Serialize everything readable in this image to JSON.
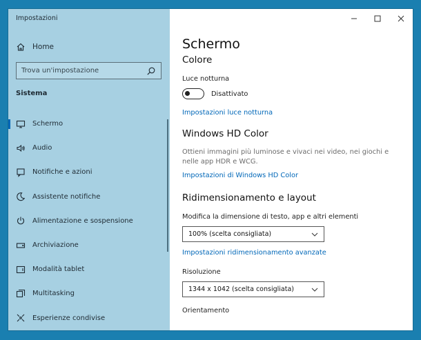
{
  "window": {
    "title": "Impostazioni"
  },
  "sidebar": {
    "home_label": "Home",
    "search_placeholder": "Trova un'impostazione",
    "section": "Sistema",
    "items": [
      {
        "label": "Schermo",
        "icon": "monitor-icon",
        "active": true
      },
      {
        "label": "Audio",
        "icon": "speaker-icon"
      },
      {
        "label": "Notifiche e azioni",
        "icon": "notification-icon"
      },
      {
        "label": "Assistente notifiche",
        "icon": "moon-icon"
      },
      {
        "label": "Alimentazione e sospensione",
        "icon": "power-icon"
      },
      {
        "label": "Archiviazione",
        "icon": "storage-icon"
      },
      {
        "label": "Modalità tablet",
        "icon": "tablet-icon"
      },
      {
        "label": "Multitasking",
        "icon": "multitasking-icon"
      },
      {
        "label": "Esperienze condivise",
        "icon": "shared-experiences-icon"
      }
    ]
  },
  "content": {
    "page_title": "Schermo",
    "color_heading": "Colore",
    "night_light_label": "Luce notturna",
    "night_light_state": "Disattivato",
    "night_light_link": "Impostazioni luce notturna",
    "hd_heading": "Windows HD Color",
    "hd_desc": "Ottieni immagini più luminose e vivaci nei video, nei giochi e nelle app HDR e WCG.",
    "hd_link": "Impostazioni di Windows HD Color",
    "scale_heading": "Ridimensionamento e layout",
    "scale_label": "Modifica la dimensione di testo, app e altri elementi",
    "scale_value": "100% (scelta consigliata)",
    "scale_link": "Impostazioni ridimensionamento avanzate",
    "resolution_label": "Risoluzione",
    "resolution_value": "1344 x 1042 (scelta consigliata)",
    "orientation_label": "Orientamento"
  },
  "colors": {
    "accent": "#0067b8",
    "sidebar_bg": "#a7d0e2",
    "desktop_bg": "#1a7fb0"
  }
}
